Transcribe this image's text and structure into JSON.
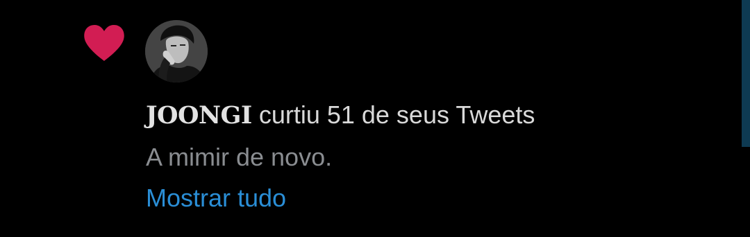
{
  "notification": {
    "type_icon": "heart-icon",
    "icon_color": "#d21d53",
    "avatar": "user-avatar",
    "username": "JOONGI",
    "action_text": "curtiu 51 de seus Tweets",
    "tweet_text": "A mimir de novo.",
    "show_all_label": "Mostrar tudo",
    "link_color": "#2a8ed6"
  }
}
